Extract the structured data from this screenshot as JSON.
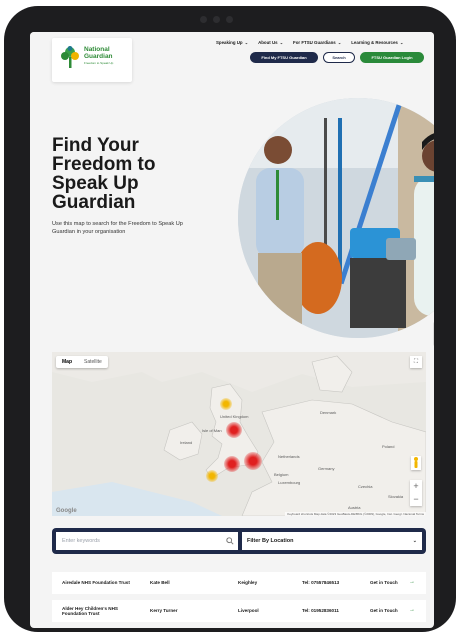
{
  "logo": {
    "line1": "National",
    "line2": "Guardian",
    "sub": "Freedom to Speak Up"
  },
  "nav": {
    "items": [
      {
        "label": "Speaking Up"
      },
      {
        "label": "About Us"
      },
      {
        "label": "For FTSU Guardians"
      },
      {
        "label": "Learning & Resources"
      }
    ],
    "find_button": "Find My FTSU Guardian",
    "search_button": "Search",
    "login_button": "FTSU Guardian Login"
  },
  "hero": {
    "title": "Find Your Freedom to Speak Up Guardian",
    "description": "Use this map to search for the Freedom to Speak Up Guardian in your organisation"
  },
  "map": {
    "tab_map": "Map",
    "tab_satellite": "Satellite",
    "labels": {
      "uk": "United Kingdom",
      "isle": "Isle of Man",
      "ireland": "Ireland",
      "denmark": "Denmark",
      "netherlands": "Netherlands",
      "germany": "Germany",
      "belgium": "Belgium",
      "luxembourg": "Luxembourg",
      "poland": "Poland",
      "czechia": "Czechia",
      "slovakia": "Slovakia",
      "austria": "Austria"
    },
    "google": "Google",
    "attribution": "Keyboard shortcuts   Map data ©2023 GeoBasis-DE/BKG (©2009), Google, Inst. Geogr. Nacional   Terms"
  },
  "filters": {
    "keyword_placeholder": "Enter keywords",
    "location_label": "Filter By Location"
  },
  "results": [
    {
      "trust": "Airedale NHS Foundation Trust",
      "name": "Kate Bell",
      "location": "Keighley",
      "tel": "Tel: 07557846513",
      "action": "Get in Touch",
      "arrow": "→"
    },
    {
      "trust": "Alder Hey Children's NHS Foundation Trust",
      "name": "Kerry Turner",
      "location": "Liverpool",
      "tel": "Tel: 01952836011",
      "action": "Get in Touch",
      "arrow": "→"
    }
  ],
  "colors": {
    "navy": "#1f2a4a",
    "green": "#2a8a3a",
    "marker_red": "#e02020",
    "marker_yellow": "#f2b600"
  }
}
